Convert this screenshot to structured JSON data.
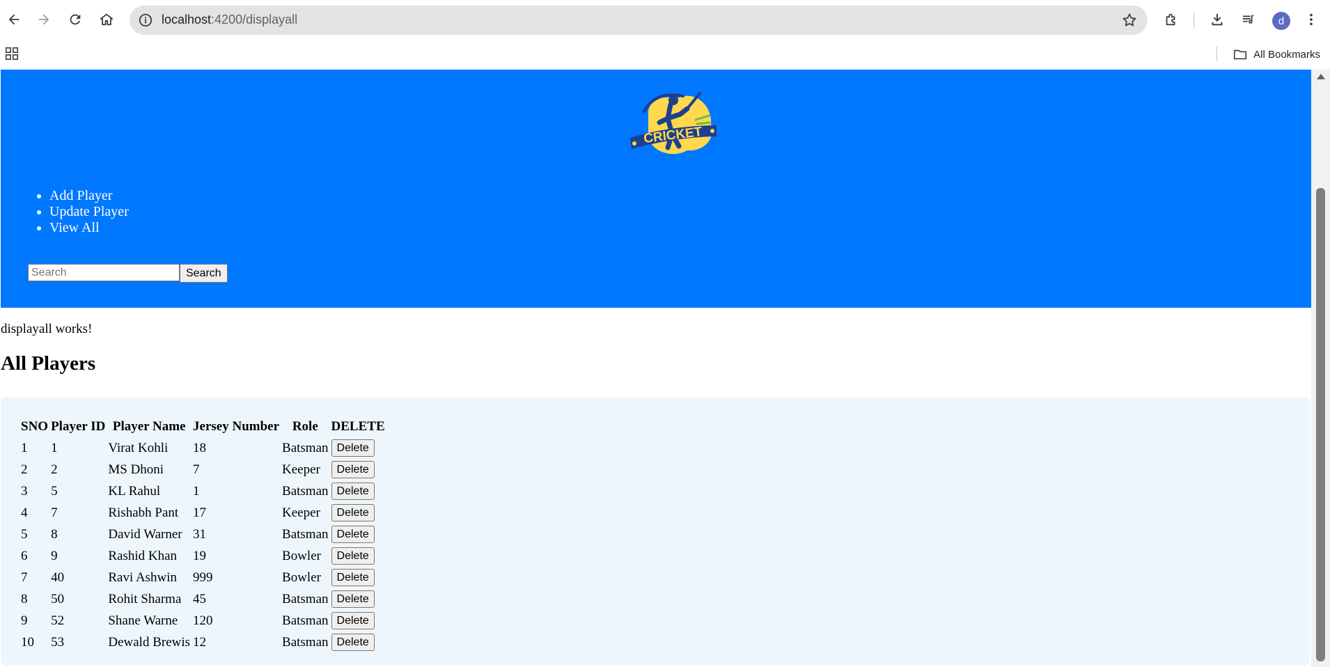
{
  "browser": {
    "url_host": "localhost",
    "url_path": ":4200/displayall",
    "bookmarks_label": "All Bookmarks",
    "profile_initial": "d"
  },
  "header": {
    "logo_text": "CRICKET",
    "nav": [
      "Add Player",
      "Update Player",
      "View All"
    ],
    "search_placeholder": "Search",
    "search_value": "",
    "search_button": "Search"
  },
  "main": {
    "status_text": "displayall works!",
    "title": "All Players",
    "table": {
      "columns": [
        "SNO",
        "Player ID",
        "Player Name",
        "Jersey Number",
        "Role",
        "DELETE"
      ],
      "rows": [
        {
          "sno": "1",
          "id": "1",
          "name": "Virat Kohli",
          "jersey": "18",
          "role": "Batsman",
          "action": "Delete"
        },
        {
          "sno": "2",
          "id": "2",
          "name": "MS Dhoni",
          "jersey": "7",
          "role": "Keeper",
          "action": "Delete"
        },
        {
          "sno": "3",
          "id": "5",
          "name": "KL Rahul",
          "jersey": "1",
          "role": "Batsman",
          "action": "Delete"
        },
        {
          "sno": "4",
          "id": "7",
          "name": "Rishabh Pant",
          "jersey": "17",
          "role": "Keeper",
          "action": "Delete"
        },
        {
          "sno": "5",
          "id": "8",
          "name": "David Warner",
          "jersey": "31",
          "role": "Batsman",
          "action": "Delete"
        },
        {
          "sno": "6",
          "id": "9",
          "name": "Rashid Khan",
          "jersey": "19",
          "role": "Bowler",
          "action": "Delete"
        },
        {
          "sno": "7",
          "id": "40",
          "name": "Ravi Ashwin",
          "jersey": "999",
          "role": "Bowler",
          "action": "Delete"
        },
        {
          "sno": "8",
          "id": "50",
          "name": "Rohit Sharma",
          "jersey": "45",
          "role": "Batsman",
          "action": "Delete"
        },
        {
          "sno": "9",
          "id": "52",
          "name": "Shane Warne",
          "jersey": "120",
          "role": "Batsman",
          "action": "Delete"
        },
        {
          "sno": "10",
          "id": "53",
          "name": "Dewald Brewis",
          "jersey": "12",
          "role": "Batsman",
          "action": "Delete"
        }
      ]
    }
  },
  "colors": {
    "header_bg": "#0077ff",
    "table_card_bg": "#eef6fd",
    "logo_yellow": "#ffd84d",
    "logo_navy": "#1e3f8c"
  }
}
